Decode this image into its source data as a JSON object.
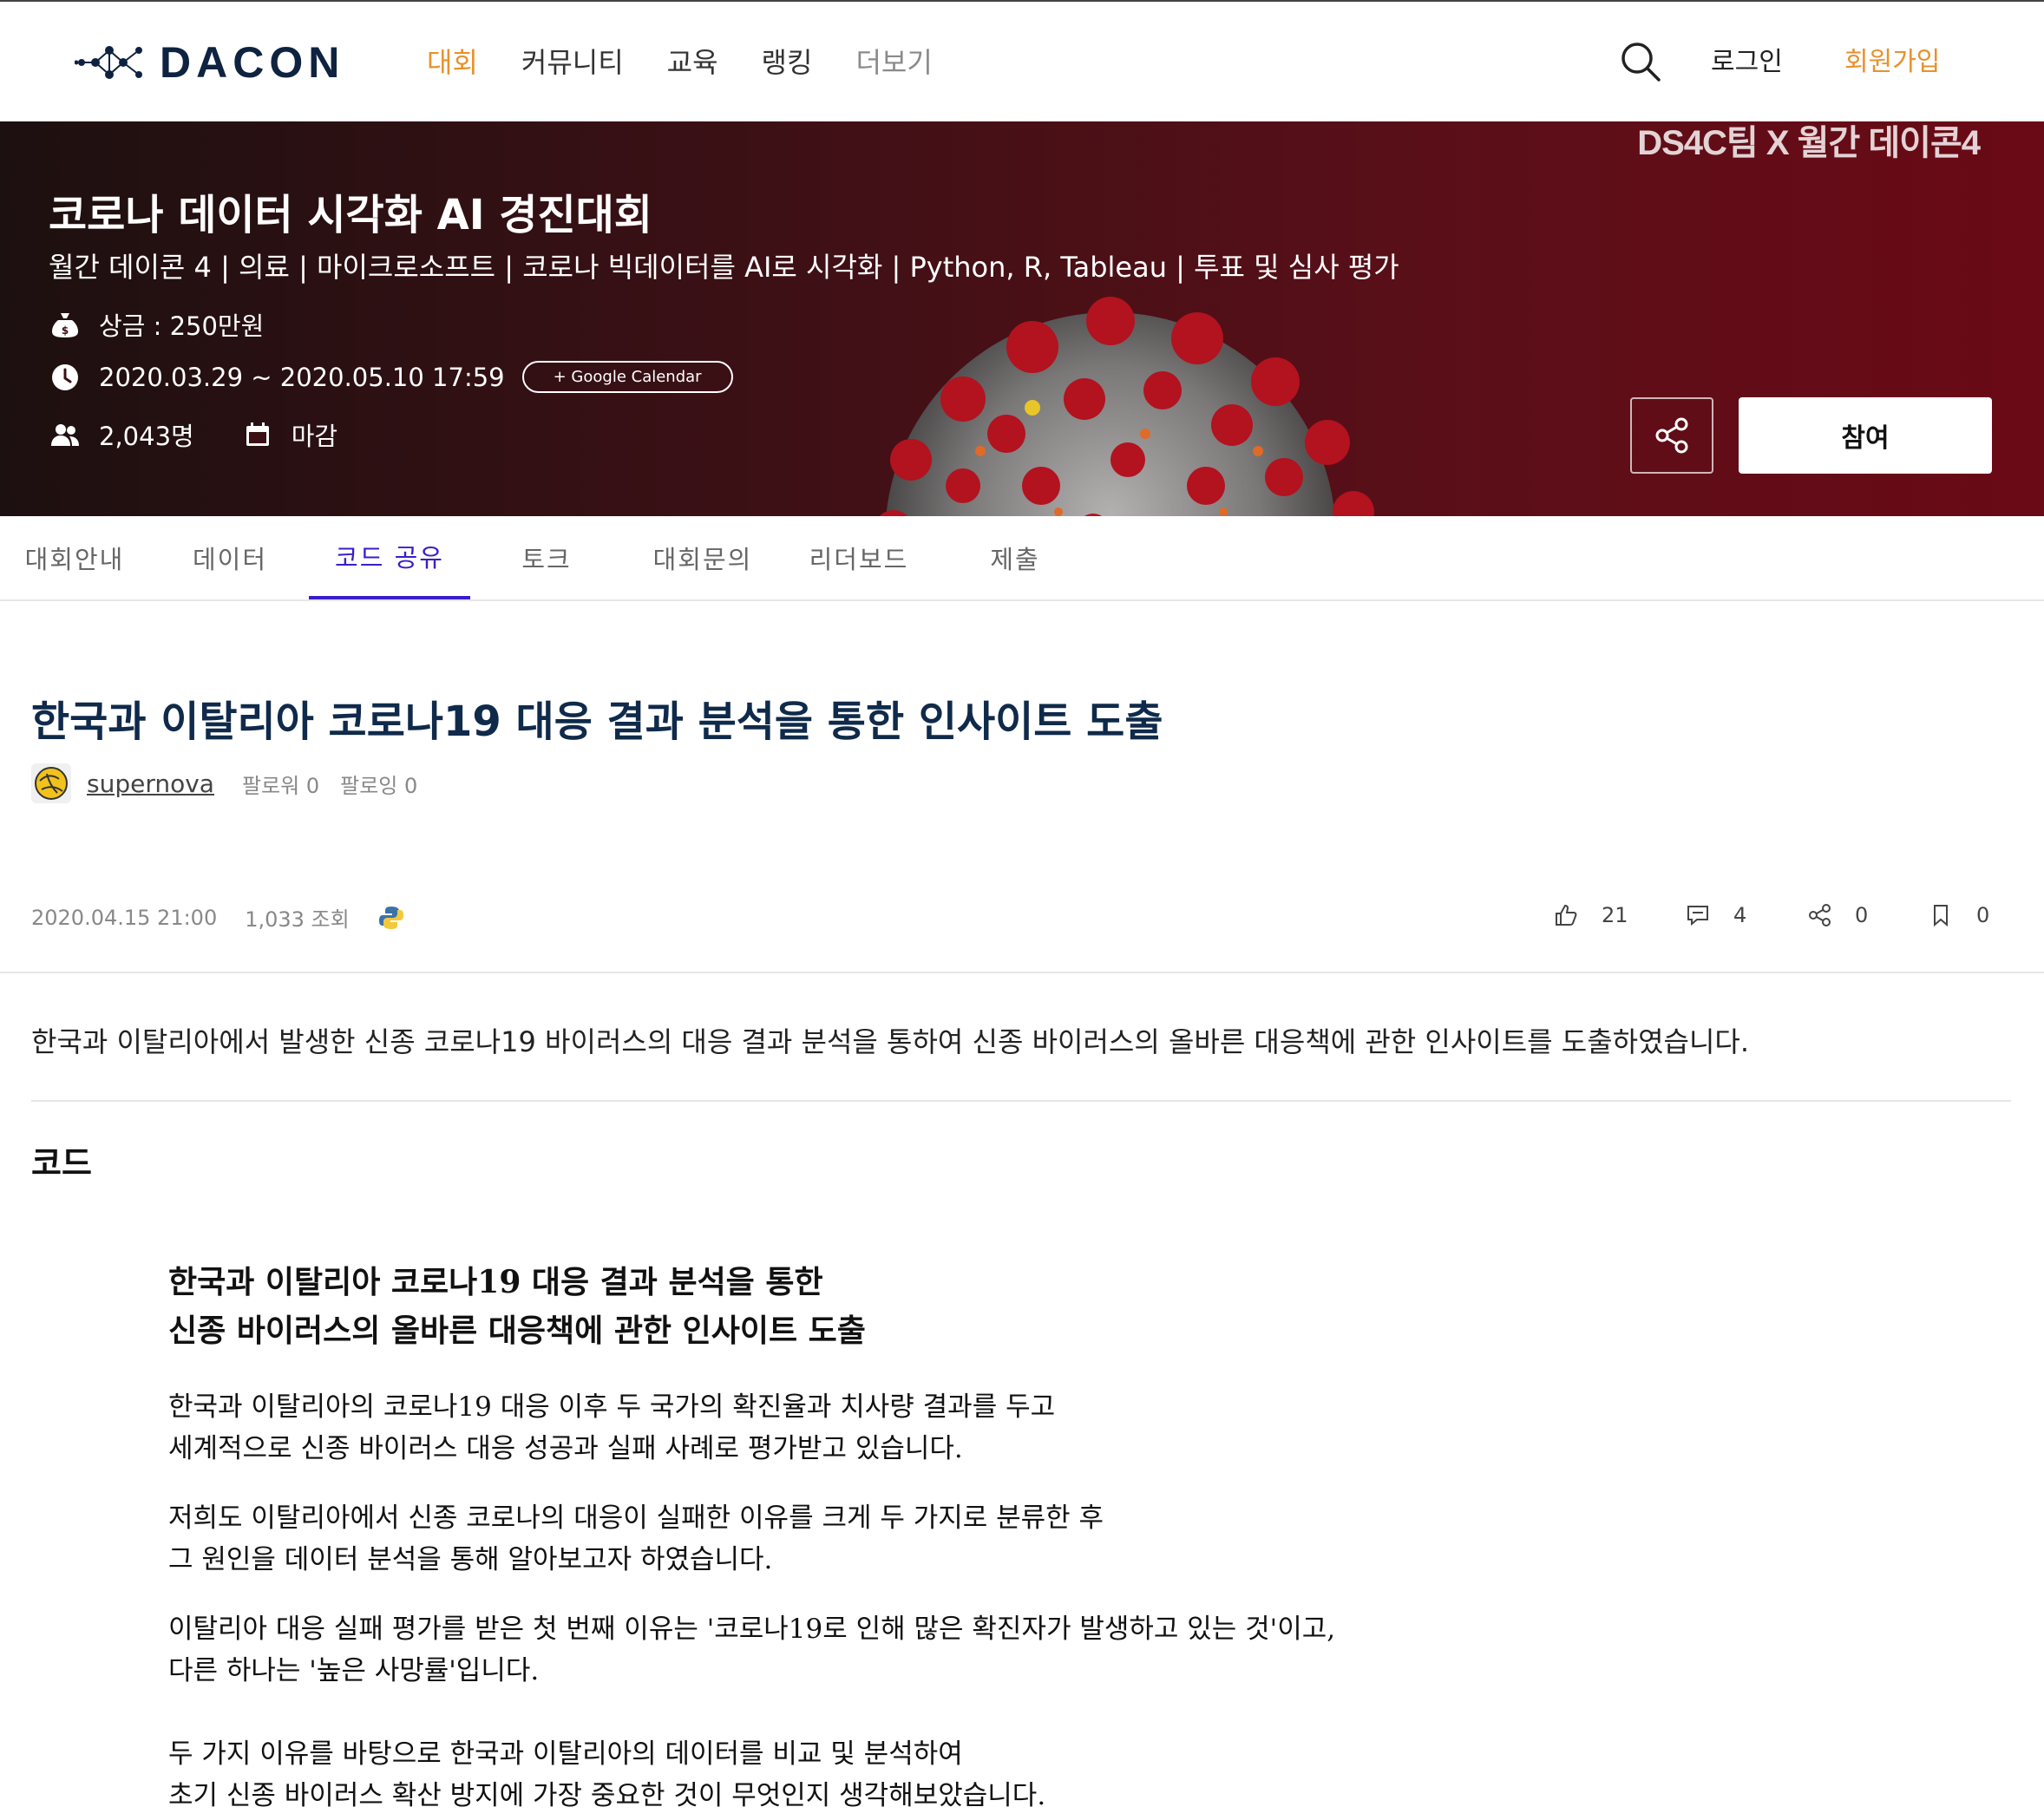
{
  "brand": {
    "name": "DACON"
  },
  "nav": {
    "items": [
      {
        "label": "대회",
        "state": "active"
      },
      {
        "label": "커뮤니티",
        "state": "normal"
      },
      {
        "label": "교육",
        "state": "normal"
      },
      {
        "label": "랭킹",
        "state": "normal"
      },
      {
        "label": "더보기",
        "state": "dim"
      }
    ],
    "login": "로그인",
    "signup": "회원가입"
  },
  "banner": {
    "corner": "DS4C팀 X 월간 데이콘4",
    "title": "코로나 데이터 시각화 AI 경진대회",
    "subtitle": "월간 데이콘 4 | 의료 | 마이크로소프트 | 코로나 빅데이터를 AI로 시각화 | Python, R, Tableau | 투표 및 심사 평가",
    "prize": "상금 : 250만원",
    "period": "2020.03.29 ~ 2020.05.10 17:59",
    "calendar_button": "+ Google Calendar",
    "participants": "2,043명",
    "status": "마감",
    "join_button": "참여"
  },
  "tabs": [
    {
      "label": "대회안내"
    },
    {
      "label": "데이터"
    },
    {
      "label": "코드 공유",
      "active": true
    },
    {
      "label": "토크"
    },
    {
      "label": "대회문의"
    },
    {
      "label": "리더보드"
    },
    {
      "label": "제출"
    }
  ],
  "post": {
    "title": "한국과 이탈리아 코로나19 대응 결과 분석을 통한 인사이트 도출",
    "author": "supernova",
    "followers": "팔로워 0",
    "following": "팔로잉 0",
    "date": "2020.04.15 21:00",
    "views": "1,033 조회",
    "likes": "21",
    "comments": "4",
    "shares": "0",
    "bookmarks": "0",
    "description": "한국과 이탈리아에서 발생한 신종 코로나19 바이러스의 대응 결과 분석을 통하여 신종 바이러스의 올바른 대응책에 관한 인사이트를 도출하였습니다.",
    "code_heading": "코드"
  },
  "notebook": {
    "heading_line1": "한국과 이탈리아 코로나19 대응 결과 분석을 통한",
    "heading_line2": "신종 바이러스의 올바른 대응책에 관한 인사이트 도출",
    "p1_line1": "한국과 이탈리아의 코로나19 대응 이후 두 국가의 확진율과 치사량 결과를 두고",
    "p1_line2": "세계적으로 신종 바이러스 대응 성공과 실패 사례로 평가받고 있습니다.",
    "p2_line1": "저희도 이탈리아에서 신종 코로나의 대응이 실패한 이유를 크게 두 가지로 분류한 후",
    "p2_line2": "그 원인을 데이터 분석을 통해 알아보고자 하였습니다.",
    "p3_line1": "이탈리아 대응 실패 평가를 받은 첫 번째 이유는 '코로나19로 인해 많은 확진자가 발생하고 있는 것'이고,",
    "p3_line2": "다른 하나는 '높은 사망률'입니다.",
    "p4_line1": "두 가지 이유를 바탕으로 한국과 이탈리아의 데이터를 비교 및 분석하여",
    "p4_line2": "초기 신종 바이러스 확산 방지에 가장 중요한 것이 무엇인지 생각해보았습니다."
  },
  "colors": {
    "accent_orange": "#e8912c",
    "tab_active": "#3a1ec8",
    "title_navy": "#0f2a4a",
    "banner_red": "#6a0a16"
  },
  "icons": {
    "logo": "constellation-logo-icon",
    "search": "search-icon",
    "prize": "money-bag-icon",
    "period": "clock-icon",
    "participants": "people-icon",
    "status": "calendar-icon",
    "share": "share-icon",
    "language": "python-icon",
    "like": "thumbs-up-icon",
    "comment": "comment-icon",
    "bookmark": "bookmark-icon"
  }
}
